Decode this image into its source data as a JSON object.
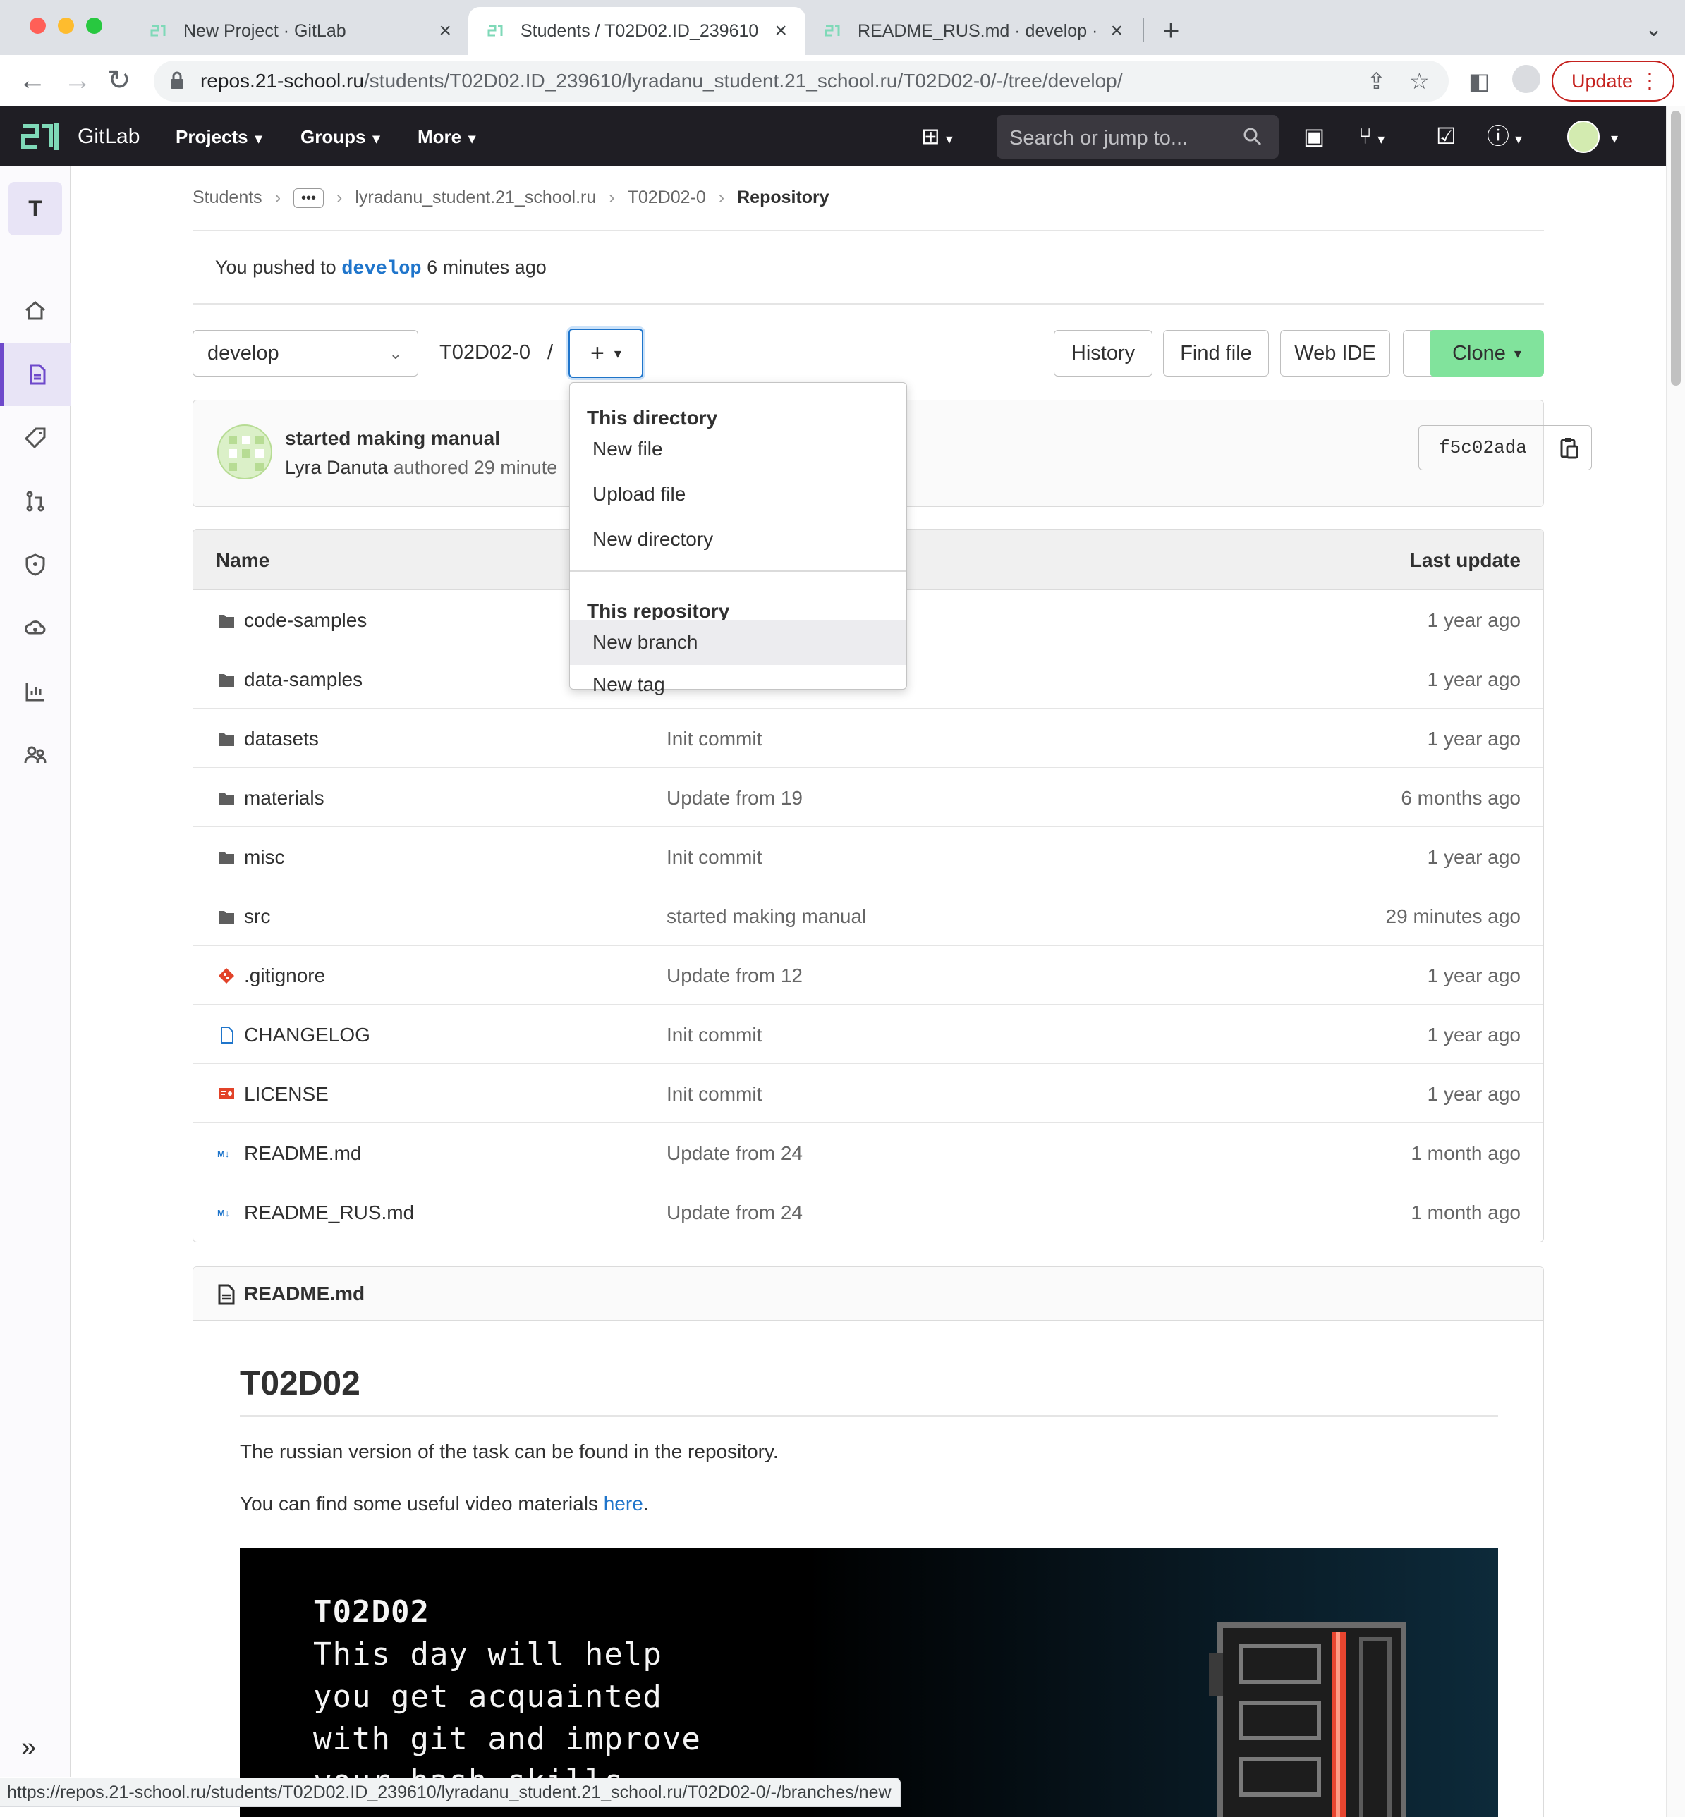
{
  "browser": {
    "tabs": [
      {
        "label": "New Project · GitLab"
      },
      {
        "label": "Students / T02D02.ID_239610"
      },
      {
        "label": "README_RUS.md · develop · S"
      }
    ],
    "url_host": "repos.21-school.ru",
    "url_path": "/students/T02D02.ID_239610/lyradanu_student.21_school.ru/T02D02-0/-/tree/develop/",
    "update_label": "Update",
    "status_url": "https://repos.21-school.ru/students/T02D02.ID_239610/lyradanu_student.21_school.ru/T02D02-0/-/branches/new"
  },
  "gitlab": {
    "brand": "GitLab",
    "nav": {
      "projects": "Projects",
      "groups": "Groups",
      "more": "More"
    },
    "search_placeholder": "Search or jump to..."
  },
  "sidebar": {
    "project_letter": "T",
    "items": [
      "project-overview",
      "repository",
      "issues-labels",
      "merge-requests",
      "security",
      "deployments",
      "analytics",
      "members"
    ]
  },
  "breadcrumb": {
    "items": [
      "Students",
      "lyradanu_student.21_school.ru",
      "T02D02-0"
    ],
    "current": "Repository"
  },
  "push_notice": {
    "prefix": "You pushed to",
    "branch": "develop",
    "suffix": "6 minutes ago"
  },
  "repo_toolbar": {
    "branch": "develop",
    "path": "T02D02-0",
    "path_sep": "/",
    "history": "History",
    "find_file": "Find file",
    "web_ide": "Web IDE",
    "clone": "Clone"
  },
  "add_dropdown": {
    "this_directory": "This directory",
    "new_file": "New file",
    "upload_file": "Upload file",
    "new_directory": "New directory",
    "this_repository": "This repository",
    "new_branch": "New branch",
    "new_tag": "New tag"
  },
  "last_commit": {
    "title": "started making manual",
    "author": "Lyra Danuta",
    "meta": "authored 29 minute",
    "sha": "f5c02ada"
  },
  "file_table": {
    "col_name": "Name",
    "col_last_update": "Last update",
    "rows": [
      {
        "name": "code-samples",
        "type": "folder",
        "message": "",
        "updated": "1 year ago"
      },
      {
        "name": "data-samples",
        "type": "folder",
        "message": "",
        "updated": "1 year ago"
      },
      {
        "name": "datasets",
        "type": "folder",
        "message": "Init commit",
        "updated": "1 year ago"
      },
      {
        "name": "materials",
        "type": "folder",
        "message": "Update from 19",
        "updated": "6 months ago"
      },
      {
        "name": "misc",
        "type": "folder",
        "message": "Init commit",
        "updated": "1 year ago"
      },
      {
        "name": "src",
        "type": "folder",
        "message": "started making manual",
        "updated": "29 minutes ago"
      },
      {
        "name": ".gitignore",
        "type": "git",
        "message": "Update from 12",
        "updated": "1 year ago"
      },
      {
        "name": "CHANGELOG",
        "type": "file",
        "message": "Init commit",
        "updated": "1 year ago"
      },
      {
        "name": "LICENSE",
        "type": "license",
        "message": "Init commit",
        "updated": "1 year ago"
      },
      {
        "name": "README.md",
        "type": "markdown",
        "message": "Update from 24",
        "updated": "1 month ago"
      },
      {
        "name": "README_RUS.md",
        "type": "markdown",
        "message": "Update from 24",
        "updated": "1 month ago"
      }
    ]
  },
  "readme": {
    "filename": "README.md",
    "heading": "T02D02",
    "p1": "The russian version of the task can be found in the repository.",
    "p2_prefix": "You can find some useful video materials",
    "p2_link": "here",
    "p2_suffix": ".",
    "banner_lines": [
      "T02D02",
      "This day will help",
      "you get acquainted",
      "with git and improve",
      "your bash skills"
    ]
  },
  "colors": {
    "gitlab_topbar": "#1f1e24",
    "clone_button": "#81e39c",
    "link": "#1f75cb",
    "sidebar_active": "#6e49cb"
  }
}
